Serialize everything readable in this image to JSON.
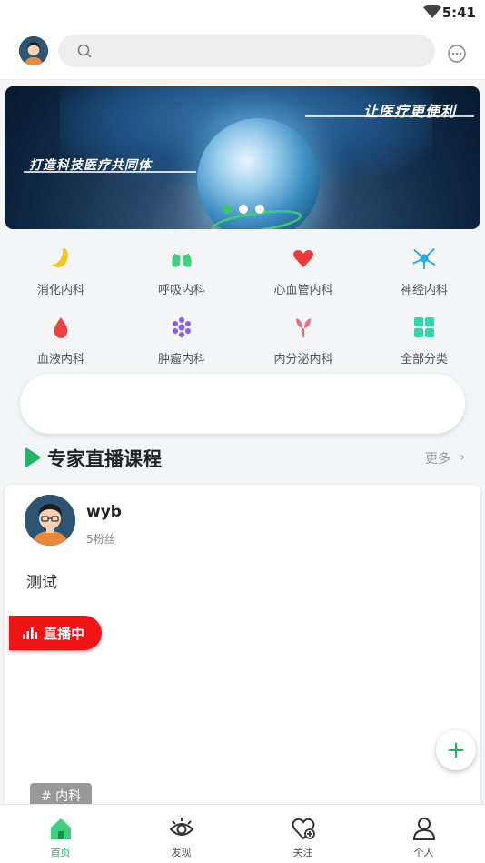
{
  "status_bar": {
    "time": "5:41"
  },
  "header": {
    "search": {
      "placeholder": ""
    }
  },
  "banner": {
    "slogan_right": "让医疗更便利",
    "slogan_left": "打造科技医疗共同体",
    "slide_count": 3,
    "active_slide": 0
  },
  "categories": [
    {
      "label": "消化内科",
      "icon": "stomach-icon",
      "color": "#f5c518"
    },
    {
      "label": "呼吸内科",
      "icon": "lungs-icon",
      "color": "#3ed07a"
    },
    {
      "label": "心血管内科",
      "icon": "heart-icon",
      "color": "#f03a3a"
    },
    {
      "label": "神经内科",
      "icon": "neuron-icon",
      "color": "#29a8e8"
    },
    {
      "label": "血液内科",
      "icon": "blood-drop-icon",
      "color": "#f04040"
    },
    {
      "label": "肿瘤内科",
      "icon": "cells-icon",
      "color": "#8a5cf0"
    },
    {
      "label": "内分泌内科",
      "icon": "gland-icon",
      "color": "#f06a8a"
    },
    {
      "label": "全部分类",
      "icon": "grid-icon",
      "color": "#2ed8a8"
    }
  ],
  "section": {
    "title": "专家直播课程",
    "more_label": "更多",
    "more_icon": "chevron-right-icon"
  },
  "course_card": {
    "author_name": "wyb",
    "author_fans": "5粉丝",
    "title": "测试",
    "live_label": "直播中",
    "tag": "# 内科"
  },
  "fab": {
    "label": "+"
  },
  "bottom_nav": [
    {
      "label": "首页",
      "icon": "home-icon",
      "active": true
    },
    {
      "label": "发现",
      "icon": "eye-icon",
      "active": false
    },
    {
      "label": "关注",
      "icon": "heart-plus-icon",
      "active": false
    },
    {
      "label": "个人",
      "icon": "person-icon",
      "active": false
    }
  ],
  "colors": {
    "accent": "#27ae60",
    "live": "#f01414"
  }
}
